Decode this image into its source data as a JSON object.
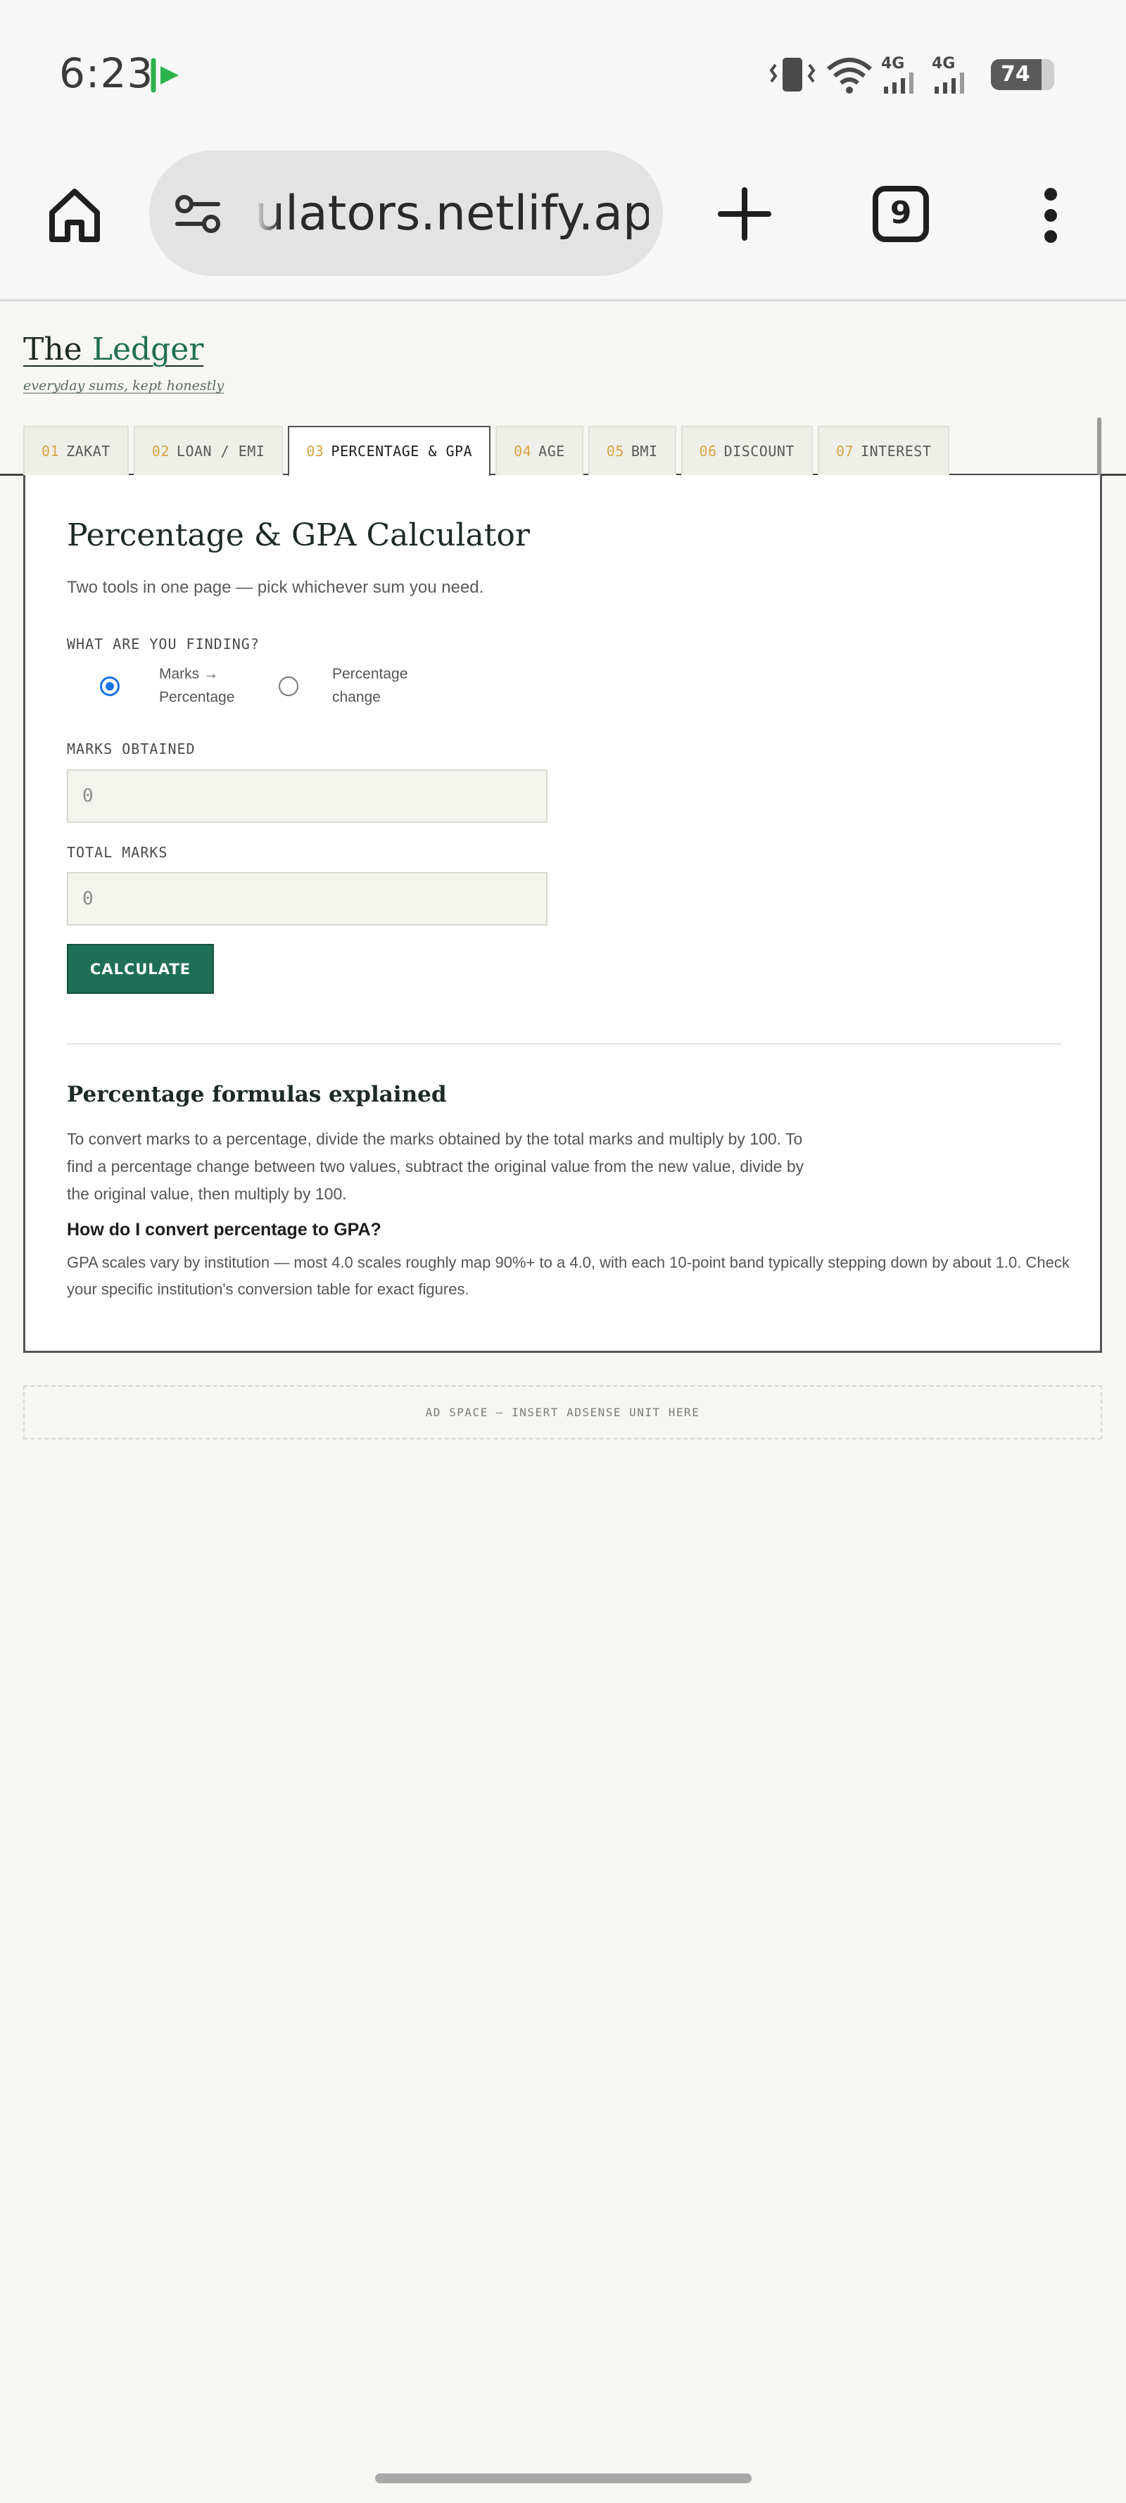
{
  "status_bar": {
    "time": "6:23",
    "battery": "74",
    "network_1": "4G",
    "network_2": "4G"
  },
  "browser": {
    "url": "ulators.netlify.app",
    "tab_count": "9"
  },
  "site": {
    "brand_prefix": "The ",
    "brand_accent": "Ledger",
    "tagline": "everyday sums, kept honestly"
  },
  "tabs": [
    {
      "num": "01",
      "label": "ZAKAT",
      "active": false
    },
    {
      "num": "02",
      "label": "LOAN / EMI",
      "active": false
    },
    {
      "num": "03",
      "label": "PERCENTAGE & GPA",
      "active": true
    },
    {
      "num": "04",
      "label": "AGE",
      "active": false
    },
    {
      "num": "05",
      "label": "BMI",
      "active": false
    },
    {
      "num": "06",
      "label": "DISCOUNT",
      "active": false
    },
    {
      "num": "07",
      "label": "INTEREST",
      "active": false
    }
  ],
  "calculator": {
    "title": "Percentage & GPA Calculator",
    "subtitle": "Two tools in one page — pick whichever sum you need.",
    "mode_label": "WHAT ARE YOU FINDING?",
    "mode_options": [
      {
        "line1": "Marks →",
        "line2": "Percentage",
        "checked": true
      },
      {
        "line1": "Percentage",
        "line2": "change",
        "checked": false
      }
    ],
    "marks_obtained_label": "MARKS OBTAINED",
    "marks_obtained_value": "0",
    "total_marks_label": "TOTAL MARKS",
    "total_marks_value": "0",
    "calculate_label": "CALCULATE"
  },
  "explainer": {
    "title": "Percentage formulas explained",
    "body": "To convert marks to a percentage, divide the marks obtained by the total marks and multiply by 100. To find a percentage change between two values, subtract the original value from the new value, divide by the original value, then multiply by 100.",
    "faq_question": "How do I convert percentage to GPA?",
    "faq_answer": "GPA scales vary by institution — most 4.0 scales roughly map 90%+ to a 4.0, with each 10-point band typically stepping down by about 1.0. Check your specific institution's conversion table for exact figures."
  },
  "ad": {
    "text": "AD SPACE — INSERT ADSENSE UNIT HERE"
  },
  "colors": {
    "accent_green": "#1f6f57",
    "tab_number": "#d9a441",
    "radio_blue": "#1a73e8"
  }
}
